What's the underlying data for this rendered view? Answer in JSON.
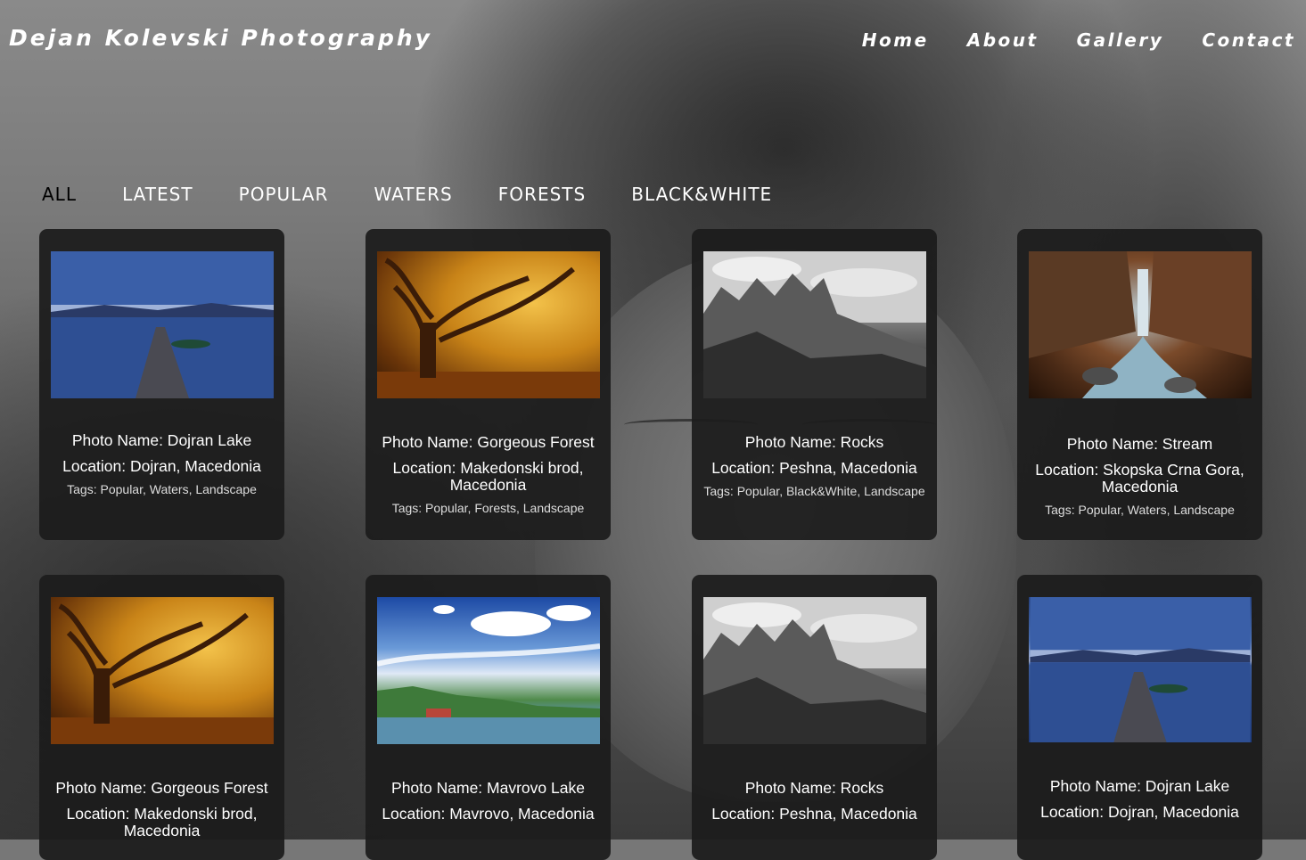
{
  "header": {
    "brand": "Dejan Kolevski Photography",
    "nav": [
      "Home",
      "About",
      "Gallery",
      "Contact"
    ]
  },
  "filters": [
    "ALL",
    "LATEST",
    "POPULAR",
    "WATERS",
    "FORESTS",
    "BLACK&WHITE"
  ],
  "active_filter": "ALL",
  "cards": [
    {
      "name": "Photo Name: Dojran Lake",
      "location": "Location: Dojran, Macedonia",
      "tags": "Tags: Popular, Waters, Landscape",
      "photo": "lake"
    },
    {
      "name": "Photo Name: Gorgeous Forest",
      "location": "Location: Makedonski brod, Macedonia",
      "tags": "Tags: Popular, Forests, Landscape",
      "photo": "forest"
    },
    {
      "name": "Photo Name: Rocks",
      "location": "Location: Peshna, Macedonia",
      "tags": "Tags: Popular, Black&White, Landscape",
      "photo": "rocks"
    },
    {
      "name": "Photo Name: Stream",
      "location": "Location: Skopska Crna Gora, Macedonia",
      "tags": "Tags: Popular, Waters, Landscape",
      "photo": "stream"
    },
    {
      "name": "Photo Name: Gorgeous Forest",
      "location": "Location: Makedonski brod, Macedonia",
      "tags": "",
      "photo": "forest"
    },
    {
      "name": "Photo Name: Mavrovo Lake",
      "location": "Location: Mavrovo, Macedonia",
      "tags": "",
      "photo": "mavrovo"
    },
    {
      "name": "Photo Name: Rocks",
      "location": "Location: Peshna, Macedonia",
      "tags": "",
      "photo": "rocks"
    },
    {
      "name": "Photo Name: Dojran Lake",
      "location": "Location: Dojran, Macedonia",
      "tags": "",
      "photo": "lake"
    }
  ]
}
